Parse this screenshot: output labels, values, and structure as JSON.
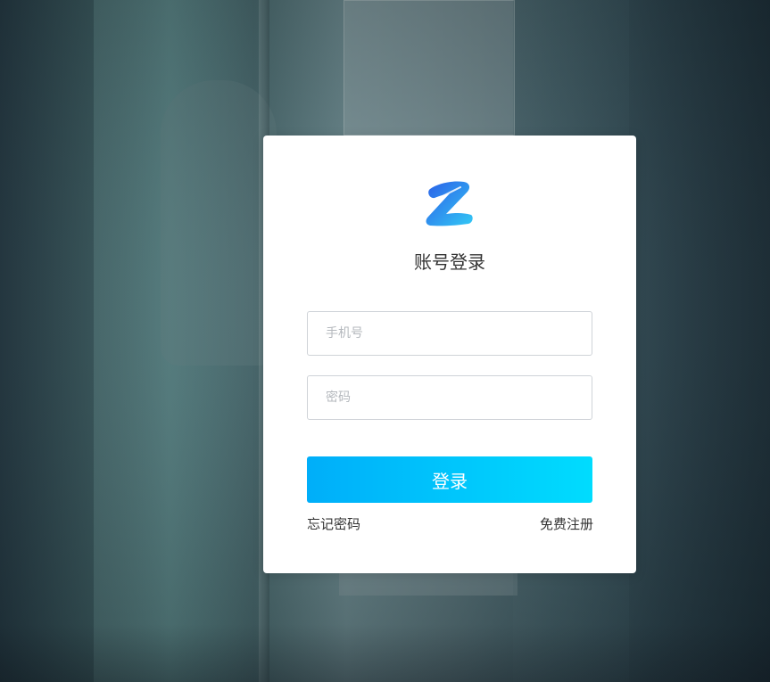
{
  "login": {
    "title": "账号登录",
    "phone_placeholder": "手机号",
    "phone_value": "",
    "password_placeholder": "密码",
    "password_value": "",
    "submit_label": "登录",
    "forgot_password_label": "忘记密码",
    "register_label": "免费注册"
  },
  "logo": {
    "icon": "z-letter-logo",
    "color_start": "#2b5fe8",
    "color_end": "#33c8f5"
  },
  "colors": {
    "button_start": "#00aef9",
    "button_end": "#00dcfe",
    "text": "#333333",
    "placeholder": "#b4b8bd"
  }
}
